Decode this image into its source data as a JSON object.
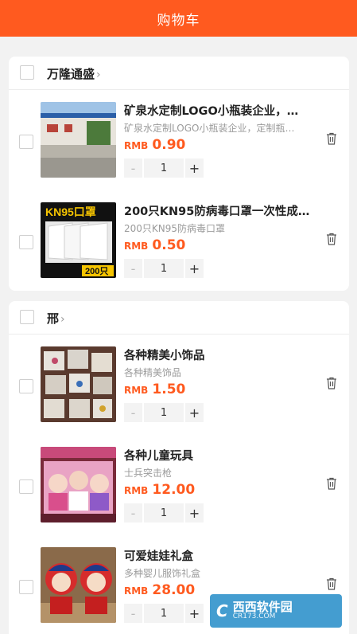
{
  "header": {
    "title": "购物车"
  },
  "shops": [
    {
      "name": "万隆通盛",
      "items": [
        {
          "name": "矿泉水定制LOGO小瓶装企业，…",
          "desc": "矿泉水定制LOGO小瓶装企业，定制瓶…",
          "currency": "RMB",
          "price": "0.90",
          "qty": "1"
        },
        {
          "name": "200只KN95防病毒口罩一次性成…",
          "desc": "200只KN95防病毒口罩",
          "currency": "RMB",
          "price": "0.50",
          "qty": "1",
          "thumb_text": "KN95口罩",
          "thumb_badge": "200只"
        }
      ]
    },
    {
      "name": "邢",
      "items": [
        {
          "name": "各种精美小饰品",
          "desc": "各种精美饰品",
          "currency": "RMB",
          "price": "1.50",
          "qty": "1"
        },
        {
          "name": "各种儿童玩具",
          "desc": "士兵突击枪",
          "currency": "RMB",
          "price": "12.00",
          "qty": "1"
        },
        {
          "name": "可爱娃娃礼盒",
          "desc": "多种婴儿服饰礼盒",
          "currency": "RMB",
          "price": "28.00",
          "qty": "1"
        }
      ]
    }
  ],
  "stepper": {
    "minus": "-",
    "plus": "+"
  },
  "shop_arrow": "›",
  "watermark": {
    "logo": "C",
    "main": "西西软件园",
    "sub": "CR173.COM"
  },
  "colors": {
    "accent": "#ff5a1f",
    "background": "#f2f2f2"
  }
}
